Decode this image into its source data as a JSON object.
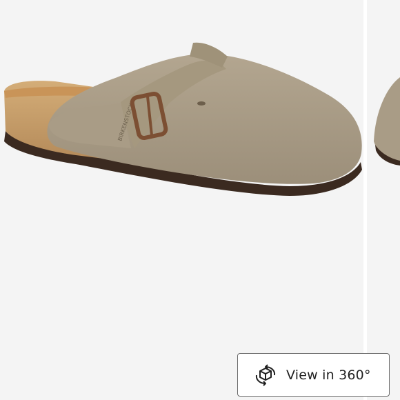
{
  "product": {
    "image_description": "Taupe suede clog with adjustable buckle strap and cork footbed",
    "brand_stamp": "BIRKENSTOCK"
  },
  "viewer": {
    "button_label": "View in 360°",
    "button_icon": "rotate-cube-icon"
  },
  "colors": {
    "background": "#f4f4f4",
    "suede": "#a89b86",
    "cork": "#c79f6c",
    "sole": "#3e2a1f",
    "buckle": "#8a5a3a"
  }
}
